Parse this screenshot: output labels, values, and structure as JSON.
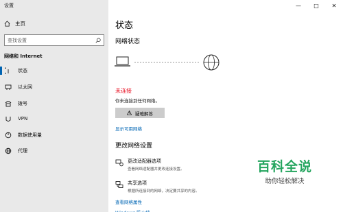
{
  "window": {
    "title": "设置",
    "minimize": "—",
    "maximize": "□",
    "close": "✕"
  },
  "sidebar": {
    "home_label": "主页",
    "search_placeholder": "查找设置",
    "section_title": "网络和 Internet",
    "items": [
      {
        "label": "状态",
        "icon": "status-icon",
        "active": true
      },
      {
        "label": "以太网",
        "icon": "ethernet-icon",
        "active": false
      },
      {
        "label": "拨号",
        "icon": "dialup-icon",
        "active": false
      },
      {
        "label": "VPN",
        "icon": "vpn-icon",
        "active": false
      },
      {
        "label": "数据使用量",
        "icon": "data-usage-icon",
        "active": false
      },
      {
        "label": "代理",
        "icon": "proxy-icon",
        "active": false
      }
    ]
  },
  "main": {
    "page_title": "状态",
    "network_status_heading": "网络状态",
    "status_text": "未连接",
    "status_desc": "你未连接到任何网络。",
    "troubleshoot_label": "疑难解答",
    "show_networks_link": "显示可用网络",
    "change_settings_heading": "更改网络设置",
    "options": [
      {
        "title": "更改适配器选项",
        "desc": "查看网络适配器并更改连接设置。",
        "icon": "adapter-icon"
      },
      {
        "title": "共享选项",
        "desc": "根据所连接到的网络，决定要共享的内容。",
        "icon": "sharing-icon"
      }
    ],
    "view_properties_link": "查看网络属性",
    "bottom_partial_link": "Windows 防火墙"
  },
  "watermark": {
    "title": "百科全说",
    "subtitle": "助你轻松解决"
  },
  "colors": {
    "accent": "#0063b1",
    "error": "#e81123",
    "link": "#0066b4",
    "watermark": "#25a55f"
  }
}
